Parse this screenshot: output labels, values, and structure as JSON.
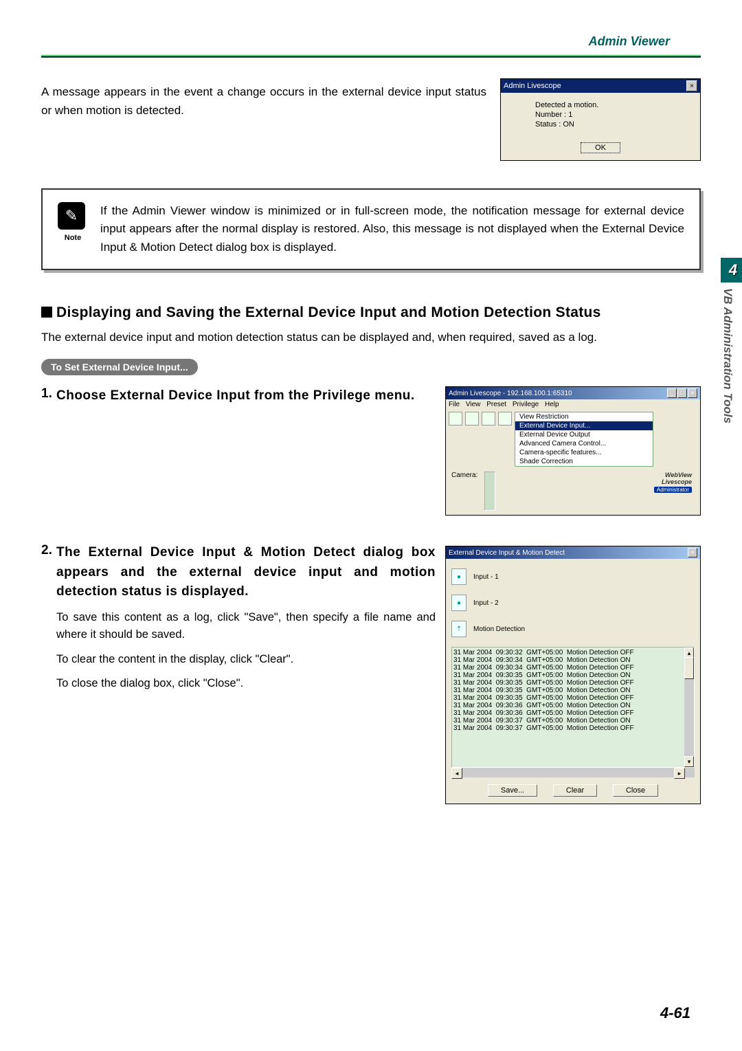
{
  "header": {
    "title": "Admin Viewer"
  },
  "sideTab": {
    "chapter": "4",
    "label": "VB Administration Tools"
  },
  "intro": "A message appears in the event a change occurs in the external device input status or when motion is detected.",
  "dialog1": {
    "title": "Admin Livescope",
    "line1": "Detected a motion.",
    "line2": "Number : 1",
    "line3": "Status : ON",
    "ok": "OK"
  },
  "note": {
    "label": "Note",
    "text": "If the Admin Viewer window is minimized or in full-screen mode, the notification message for external device input appears after the normal display is restored. Also, this message is not displayed when the External Device Input & Motion Detect dialog box is displayed."
  },
  "section": {
    "heading": "Displaying and Saving the External Device Input and Motion Detection Status",
    "paragraph": "The external device input and motion detection status can be displayed and, when required, saved as a log.",
    "pill": "To Set External Device Input..."
  },
  "step1": {
    "num": "1.",
    "title": "Choose External Device Input from the Privilege menu.",
    "screenshot": {
      "title": "Admin Livescope - 192.168.100.1:65310",
      "menus": [
        "File",
        "View",
        "Preset",
        "Privilege",
        "Help"
      ],
      "dropdown": {
        "top": "View Restriction",
        "selected": "External Device Input...",
        "items": [
          "External Device Output",
          "Advanced Camera Control...",
          "Camera-specific features...",
          "Shade Correction"
        ]
      },
      "cameraLabel": "Camera:",
      "brand1": "WebView",
      "brand2": "Livescope",
      "badge": "Administrator"
    }
  },
  "step2": {
    "num": "2.",
    "title": "The External Device Input & Motion Detect dialog box appears and the external device input and motion detection status is displayed.",
    "body1": "To save this content as a log, click \"Save\", then specify a file name and where it should be saved.",
    "body2": "To clear the content in the display, click \"Clear\".",
    "body3": "To close the dialog box, click \"Close\".",
    "screenshot": {
      "title": "External Device Input & Motion Detect",
      "input1": "Input - 1",
      "input2": "Input - 2",
      "motion": "Motion Detection",
      "log": [
        "31 Mar 2004  09:30:32  GMT+05:00  Motion Detection OFF",
        "31 Mar 2004  09:30:34  GMT+05:00  Motion Detection ON",
        "31 Mar 2004  09:30:34  GMT+05:00  Motion Detection OFF",
        "31 Mar 2004  09:30:35  GMT+05:00  Motion Detection ON",
        "31 Mar 2004  09:30:35  GMT+05:00  Motion Detection OFF",
        "31 Mar 2004  09:30:35  GMT+05:00  Motion Detection ON",
        "31 Mar 2004  09:30:35  GMT+05:00  Motion Detection OFF",
        "31 Mar 2004  09:30:36  GMT+05:00  Motion Detection ON",
        "31 Mar 2004  09:30:36  GMT+05:00  Motion Detection OFF",
        "31 Mar 2004  09:30:37  GMT+05:00  Motion Detection ON",
        "31 Mar 2004  09:30:37  GMT+05:00  Motion Detection OFF"
      ],
      "save": "Save...",
      "clear": "Clear",
      "close": "Close"
    }
  },
  "pageNum": "4-61"
}
